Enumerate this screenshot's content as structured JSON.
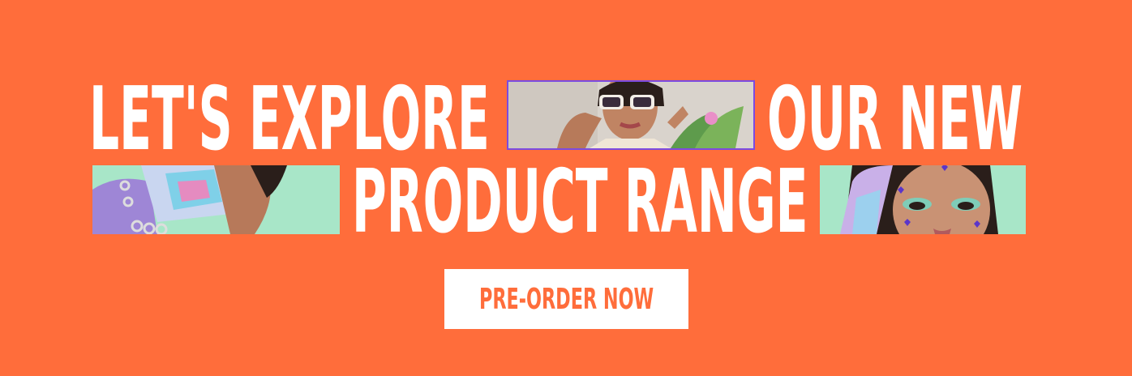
{
  "banner": {
    "headline": {
      "line1_left": "LET'S EXPLORE",
      "line1_right": "OUR NEW",
      "line2": "PRODUCT RANGE"
    },
    "cta": {
      "label": "PRE-ORDER NOW"
    }
  },
  "colors": {
    "background": "#FF6D3B",
    "headline_text": "#FFFFFF",
    "button_background": "#FFFFFF",
    "button_text": "#FF6D3B",
    "photo_accent_border": "#7B4BE0",
    "photo_mint": "#A8E6C8"
  }
}
